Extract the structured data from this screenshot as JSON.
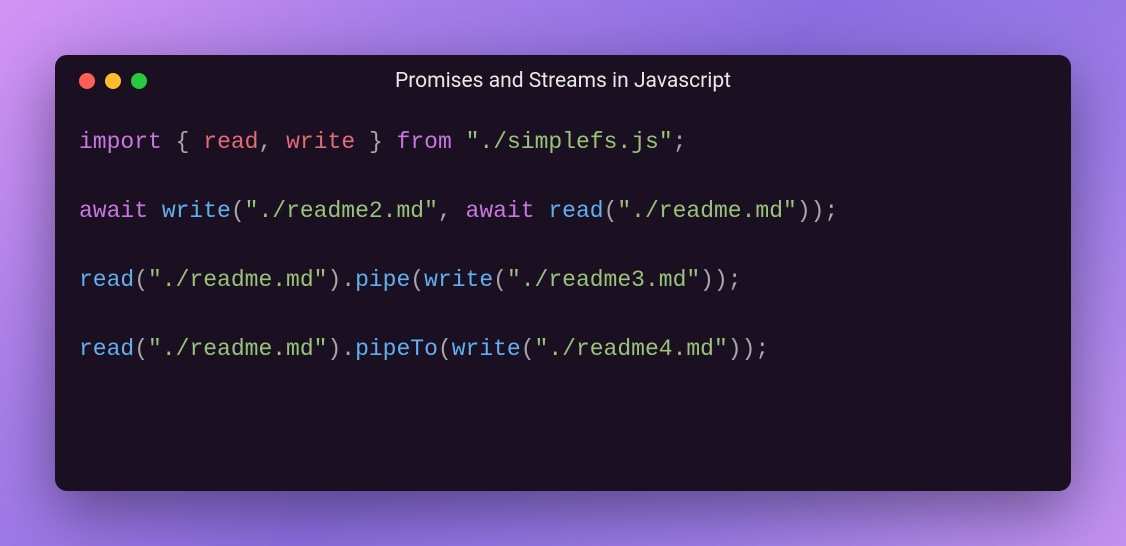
{
  "window": {
    "title": "Promises and Streams in Javascript"
  },
  "code": {
    "lines": [
      [
        {
          "t": "keyword",
          "v": "import"
        },
        {
          "t": "plain",
          "v": " "
        },
        {
          "t": "punct",
          "v": "{"
        },
        {
          "t": "plain",
          "v": " "
        },
        {
          "t": "ident",
          "v": "read"
        },
        {
          "t": "punct",
          "v": ","
        },
        {
          "t": "plain",
          "v": " "
        },
        {
          "t": "ident",
          "v": "write"
        },
        {
          "t": "plain",
          "v": " "
        },
        {
          "t": "punct",
          "v": "}"
        },
        {
          "t": "plain",
          "v": " "
        },
        {
          "t": "keyword",
          "v": "from"
        },
        {
          "t": "plain",
          "v": " "
        },
        {
          "t": "string",
          "v": "\"./simplefs.js\""
        },
        {
          "t": "punct",
          "v": ";"
        }
      ],
      [],
      [
        {
          "t": "keyword",
          "v": "await"
        },
        {
          "t": "plain",
          "v": " "
        },
        {
          "t": "call",
          "v": "write"
        },
        {
          "t": "punct",
          "v": "("
        },
        {
          "t": "string",
          "v": "\"./readme2.md\""
        },
        {
          "t": "punct",
          "v": ","
        },
        {
          "t": "plain",
          "v": " "
        },
        {
          "t": "keyword",
          "v": "await"
        },
        {
          "t": "plain",
          "v": " "
        },
        {
          "t": "call",
          "v": "read"
        },
        {
          "t": "punct",
          "v": "("
        },
        {
          "t": "string",
          "v": "\"./readme.md\""
        },
        {
          "t": "punct",
          "v": "));"
        }
      ],
      [],
      [
        {
          "t": "call",
          "v": "read"
        },
        {
          "t": "punct",
          "v": "("
        },
        {
          "t": "string",
          "v": "\"./readme.md\""
        },
        {
          "t": "punct",
          "v": ")."
        },
        {
          "t": "call",
          "v": "pipe"
        },
        {
          "t": "punct",
          "v": "("
        },
        {
          "t": "call",
          "v": "write"
        },
        {
          "t": "punct",
          "v": "("
        },
        {
          "t": "string",
          "v": "\"./readme3.md\""
        },
        {
          "t": "punct",
          "v": "));"
        }
      ],
      [],
      [
        {
          "t": "call",
          "v": "read"
        },
        {
          "t": "punct",
          "v": "("
        },
        {
          "t": "string",
          "v": "\"./readme.md\""
        },
        {
          "t": "punct",
          "v": ")."
        },
        {
          "t": "call",
          "v": "pipeTo"
        },
        {
          "t": "punct",
          "v": "("
        },
        {
          "t": "call",
          "v": "write"
        },
        {
          "t": "punct",
          "v": "("
        },
        {
          "t": "string",
          "v": "\"./readme4.md\""
        },
        {
          "t": "punct",
          "v": "));"
        }
      ]
    ]
  }
}
